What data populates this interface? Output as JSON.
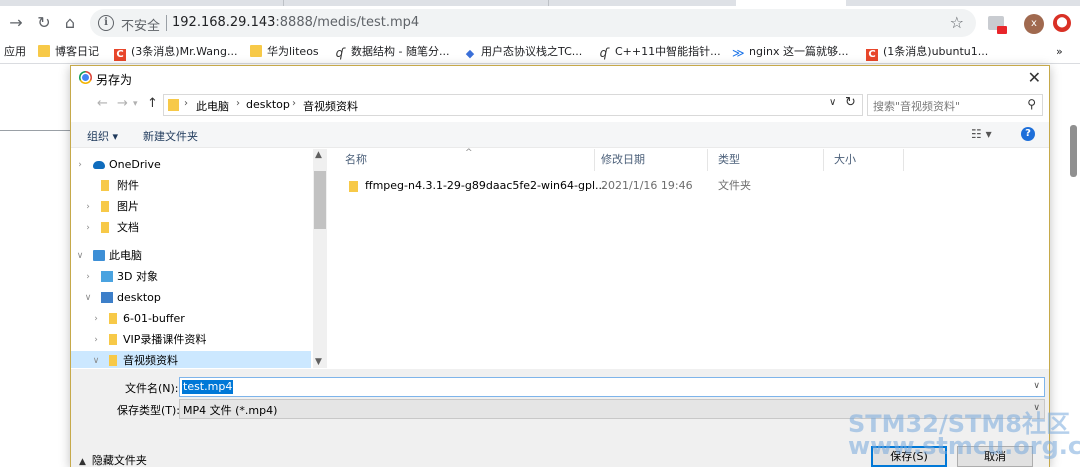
{
  "browser": {
    "omnibox": {
      "insecure_label": "不安全",
      "url_host": "192.168.29.143",
      "url_path": ":8888/medis/test.mp4"
    },
    "avatar_letter": "x",
    "bookmarks": [
      {
        "label": "应用",
        "icon": "apps-icon"
      },
      {
        "label": "博客日记",
        "icon": "folder-icon"
      },
      {
        "label": "(3条消息)Mr.Wang...",
        "icon": "csdn-icon"
      },
      {
        "label": "华为liteos",
        "icon": "folder-icon"
      },
      {
        "label": "数据结构 - 随笔分...",
        "icon": "cnblogs-icon"
      },
      {
        "label": "用户态协议栈之TC...",
        "icon": "diamond-icon"
      },
      {
        "label": "C++11中智能指针...",
        "icon": "cnblogs-icon"
      },
      {
        "label": "nginx 这一篇就够...",
        "icon": "chevrons-icon"
      },
      {
        "label": "(1条消息)ubuntu1...",
        "icon": "csdn-icon"
      }
    ],
    "bookmarks_more": "»"
  },
  "dialog": {
    "title": "另存为",
    "breadcrumbs": [
      "此电脑",
      "desktop",
      "音视频资料"
    ],
    "search_placeholder": "搜索\"音视频资料\"",
    "commands": {
      "organize": "组织 ▾",
      "new_folder": "新建文件夹"
    },
    "nav_tree": [
      {
        "label": "OneDrive",
        "icon": "cloud-icon",
        "level": 0,
        "selected": false
      },
      {
        "label": "附件",
        "icon": "folder-icon",
        "level": 1,
        "selected": false
      },
      {
        "label": "图片",
        "icon": "folder-icon",
        "level": 1,
        "selected": false
      },
      {
        "label": "文档",
        "icon": "folder-icon",
        "level": 1,
        "selected": false
      },
      {
        "label": "此电脑",
        "icon": "computer-icon",
        "level": 0,
        "selected": false
      },
      {
        "label": "3D 对象",
        "icon": "3d-objects-icon",
        "level": 1,
        "selected": false
      },
      {
        "label": "desktop",
        "icon": "desktop-icon",
        "level": 1,
        "selected": false
      },
      {
        "label": "6-01-buffer",
        "icon": "folder-icon",
        "level": 2,
        "selected": false
      },
      {
        "label": "VIP录播课件资料",
        "icon": "folder-icon",
        "level": 2,
        "selected": false
      },
      {
        "label": "音视频资料",
        "icon": "folder-icon",
        "level": 2,
        "selected": true
      }
    ],
    "columns": [
      "名称",
      "修改日期",
      "类型",
      "大小"
    ],
    "files": [
      {
        "name": "ffmpeg-n4.3.1-29-g89daac5fe2-win64-gpl...",
        "modified": "2021/1/16 19:46",
        "type": "文件夹",
        "size": ""
      }
    ],
    "filename_label": "文件名(N):",
    "filename_value": "test.mp4",
    "filetype_label": "保存类型(T):",
    "filetype_value": "MP4 文件 (*.mp4)",
    "hide_folders_label": "隐藏文件夹",
    "save_button": "保存(S)",
    "cancel_button": "取消"
  },
  "watermark": {
    "line1": "STM32/STM8社区",
    "line2": "www.stmcu.org.cn"
  },
  "colors": {
    "accent": "#0078d7",
    "selection": "#cce8ff",
    "folder": "#f7c948",
    "insecure_badge": "#d93025"
  }
}
